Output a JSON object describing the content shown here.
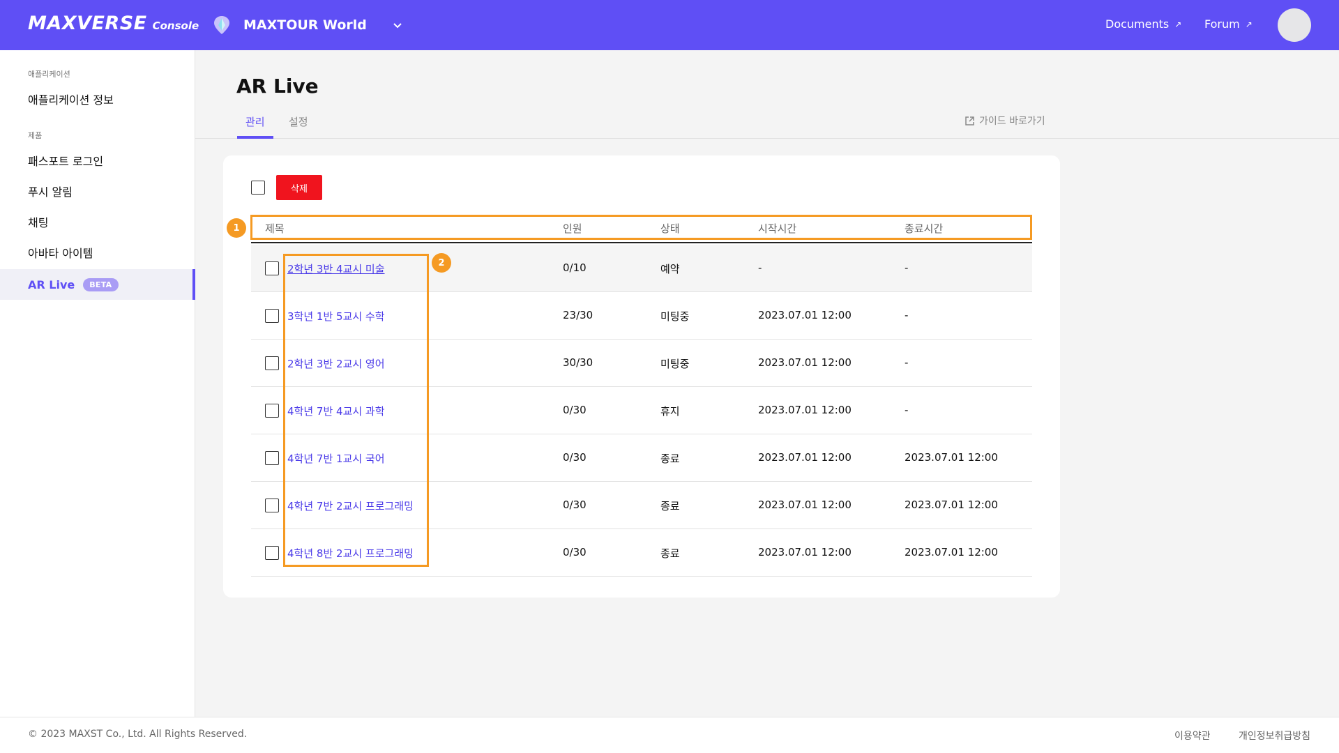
{
  "topbar": {
    "brand": "MAXVERSE",
    "brand_sub": "Console",
    "project_name": "MAXTOUR World",
    "links": {
      "documents": "Documents",
      "forum": "Forum"
    },
    "accent": "#5f4ff5"
  },
  "sidebar": {
    "group_app": "애플리케이션",
    "item_app_info": "애플리케이션 정보",
    "group_product": "제품",
    "items": [
      "패스포트 로그인",
      "푸시 알림",
      "채팅",
      "아바타 아이템"
    ],
    "active_item": "AR Live",
    "active_badge": "BETA"
  },
  "page": {
    "title": "AR Live",
    "tabs": [
      "관리",
      "설정"
    ],
    "guide_link": "가이드 바로가기"
  },
  "toolbar": {
    "delete_label": "삭제"
  },
  "table": {
    "headers": [
      "제목",
      "인원",
      "상태",
      "시작시간",
      "종료시간"
    ],
    "rows": [
      [
        "2학년 3반 4교시 미술",
        "0/10",
        "예약",
        "-",
        "-"
      ],
      [
        "3학년 1반 5교시 수학",
        "23/30",
        "미팅중",
        "2023.07.01  12:00",
        "-"
      ],
      [
        "2학년 3반 2교시 영어",
        "30/30",
        "미팅중",
        "2023.07.01  12:00",
        "-"
      ],
      [
        "4학년 7반 4교시 과학",
        "0/30",
        "휴지",
        "2023.07.01  12:00",
        "-"
      ],
      [
        "4학년 7반 1교시 국어",
        "0/30",
        "종료",
        "2023.07.01  12:00",
        "2023.07.01  12:00"
      ],
      [
        "4학년 7반 2교시 프로그래밍",
        "0/30",
        "종료",
        "2023.07.01  12:00",
        "2023.07.01  12:00"
      ],
      [
        "4학년 8반 2교시 프로그래밍",
        "0/30",
        "종료",
        "2023.07.01  12:00",
        "2023.07.01  12:00"
      ]
    ]
  },
  "annotations": {
    "badge1": "1",
    "badge2": "2",
    "color": "#f59a23"
  },
  "footer": {
    "copyright": "© 2023 MAXST Co., Ltd. All Rights Reserved.",
    "terms": "이용약관",
    "privacy": "개인정보취급방침"
  }
}
